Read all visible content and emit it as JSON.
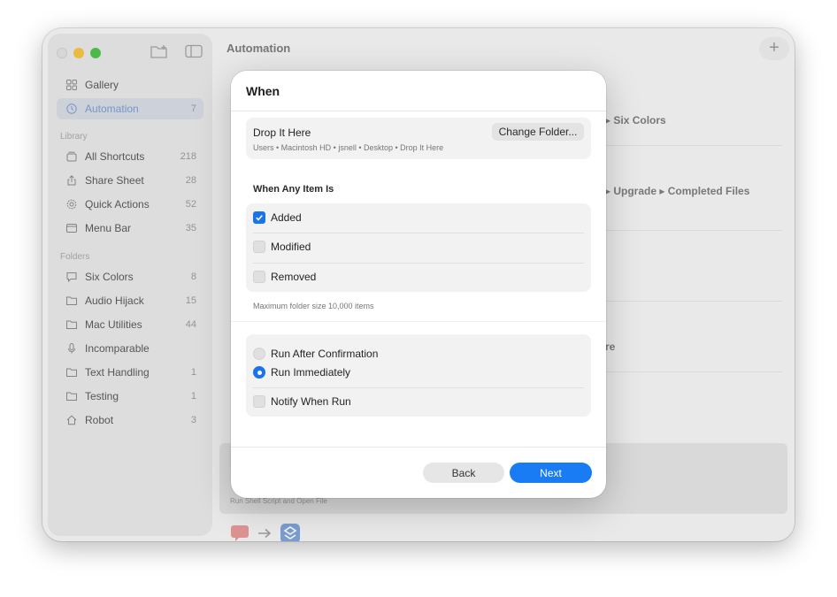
{
  "window": {
    "title": "Automation"
  },
  "sidebar": {
    "top_items": [
      {
        "label": "Gallery",
        "count": "",
        "icon": "grid-icon"
      },
      {
        "label": "Automation",
        "count": "7",
        "icon": "clock-icon",
        "active": true
      }
    ],
    "library_title": "Library",
    "library": [
      {
        "label": "All Shortcuts",
        "count": "218",
        "icon": "stack-icon"
      },
      {
        "label": "Share Sheet",
        "count": "28",
        "icon": "share-icon"
      },
      {
        "label": "Quick Actions",
        "count": "52",
        "icon": "gear-icon"
      },
      {
        "label": "Menu Bar",
        "count": "35",
        "icon": "menubar-icon"
      }
    ],
    "folders_title": "Folders",
    "folders": [
      {
        "label": "Six Colors",
        "count": "8",
        "icon": "speech-bubble-icon"
      },
      {
        "label": "Audio Hijack",
        "count": "15",
        "icon": "folder-icon"
      },
      {
        "label": "Mac Utilities",
        "count": "44",
        "icon": "folder-icon"
      },
      {
        "label": "Incomparable",
        "count": "",
        "icon": "microphone-icon"
      },
      {
        "label": "Text Handling",
        "count": "1",
        "icon": "folder-icon"
      },
      {
        "label": "Testing",
        "count": "1",
        "icon": "folder-icon"
      },
      {
        "label": "Robot",
        "count": "3",
        "icon": "house-icon"
      }
    ]
  },
  "background": {
    "rows": [
      "▸ Six Colors",
      "▸ Upgrade ▸ Completed Files",
      "re"
    ],
    "card_subtitle": "Run Shell Script and Open File"
  },
  "dialog": {
    "title": "When",
    "folder_name": "Drop It Here",
    "folder_path": "Users • Macintosh HD • jsnell • Desktop • Drop It Here",
    "change_folder_label": "Change Folder...",
    "section_title": "When Any Item Is",
    "options": [
      {
        "label": "Added",
        "checked": true
      },
      {
        "label": "Modified",
        "checked": false
      },
      {
        "label": "Removed",
        "checked": false
      }
    ],
    "note": "Maximum folder size 10,000 items",
    "run_options": [
      {
        "label": "Run After Confirmation",
        "selected": false
      },
      {
        "label": "Run Immediately",
        "selected": true
      }
    ],
    "notify_label": "Notify When Run",
    "notify_checked": false,
    "back_label": "Back",
    "next_label": "Next"
  },
  "colors": {
    "accent": "#1a7cf5",
    "sidebar_active_text": "#7e9ad0"
  }
}
